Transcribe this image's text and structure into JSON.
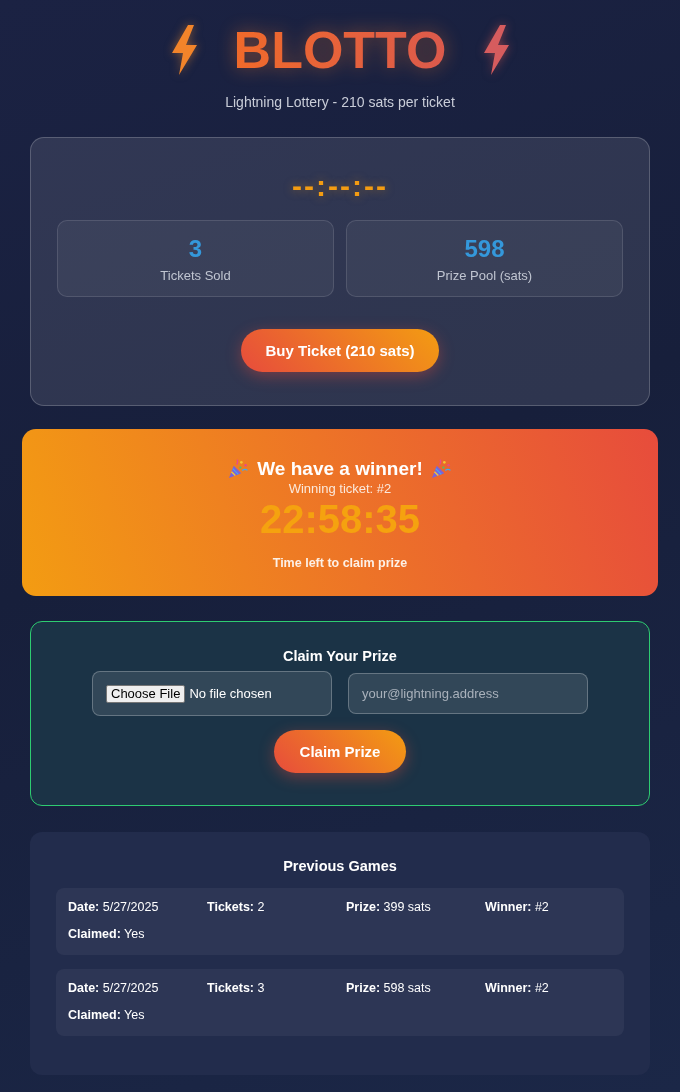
{
  "header": {
    "title": "BLOTTO",
    "subtitle": "Lightning Lottery - 210 sats per ticket"
  },
  "current_game": {
    "timer": "--:--:--",
    "stats": [
      {
        "value": "3",
        "label": "Tickets Sold"
      },
      {
        "value": "598",
        "label": "Prize Pool (sats)"
      }
    ],
    "buy_button": "Buy Ticket (210 sats)"
  },
  "winner_banner": {
    "title": "We have a winner!",
    "winning_ticket": "Winning ticket: #2",
    "countdown": "22:58:35",
    "countdown_label": "Time left to claim prize"
  },
  "claim": {
    "title": "Claim Your Prize",
    "file_input": {
      "button": "Choose File",
      "status": "No file chosen"
    },
    "address_field": {
      "placeholder": "your@lightning.address"
    },
    "submit_button": "Claim Prize"
  },
  "previous_games": {
    "title": "Previous Games",
    "games": [
      {
        "date": "**Date:** 5/27/2025",
        "tickets": "**Tickets:** 2",
        "prize": "**Prize:** 399 sats",
        "winner": "**Winner:** #2",
        "claimed": "**Claimed:** Yes"
      },
      {
        "date": "**Date:** 5/27/2025",
        "tickets": "**Tickets:** 3",
        "prize": "**Prize:** 598 sats",
        "winner": "**Winner:** #2",
        "claimed": "**Claimed:** Yes"
      }
    ]
  }
}
